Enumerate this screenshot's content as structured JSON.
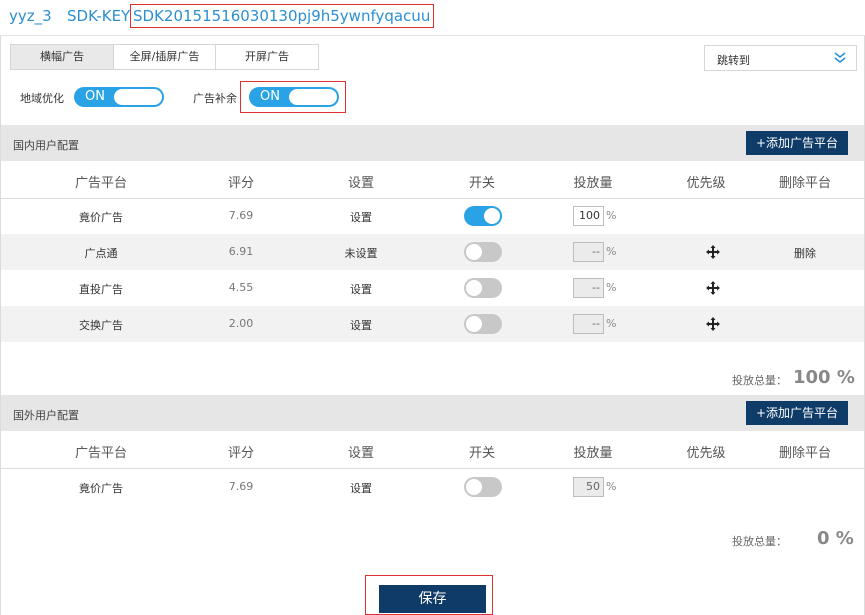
{
  "header": {
    "app_name": "yyz_3",
    "sdk_label": "SDK-KEY",
    "sdk_key": "SDK20151516030130pj9h5ywnfyqacuu"
  },
  "tabs": [
    {
      "label": "横幅广告",
      "active": true
    },
    {
      "label": "全屏/插屏广告",
      "active": false
    },
    {
      "label": "开屏广告",
      "active": false
    }
  ],
  "jump_select": {
    "label": "跳转到",
    "icon": "double-chevron-down-icon"
  },
  "options": {
    "geo_optimize": {
      "label": "地域优化",
      "state": "ON"
    },
    "ad_fill": {
      "label": "广告补余",
      "state": "ON"
    }
  },
  "domestic": {
    "title": "国内用户配置",
    "add_button": "+添加广告平台",
    "columns": [
      "广告平台",
      "评分",
      "设置",
      "开关",
      "投放量",
      "优先级",
      "删除平台"
    ],
    "rows": [
      {
        "platform": "竟价广告",
        "score": "7.69",
        "setting": "设置",
        "enabled": true,
        "quantity": "100",
        "unit": "%",
        "priority_icon": "",
        "delete": ""
      },
      {
        "platform": "广点通",
        "score": "6.91",
        "setting": "未设置",
        "enabled": false,
        "quantity": "--",
        "unit": "%",
        "priority_icon": "move-icon",
        "delete": "删除"
      },
      {
        "platform": "直投广告",
        "score": "4.55",
        "setting": "设置",
        "enabled": false,
        "quantity": "--",
        "unit": "%",
        "priority_icon": "move-icon",
        "delete": ""
      },
      {
        "platform": "交换广告",
        "score": "2.00",
        "setting": "设置",
        "enabled": false,
        "quantity": "--",
        "unit": "%",
        "priority_icon": "move-icon",
        "delete": ""
      }
    ],
    "total_label": "投放总量：",
    "total_value": "100 %"
  },
  "foreign": {
    "title": "国外用户配置",
    "add_button": "+添加广告平台",
    "columns": [
      "广告平台",
      "评分",
      "设置",
      "开关",
      "投放量",
      "优先级",
      "删除平台"
    ],
    "rows": [
      {
        "platform": "竟价广告",
        "score": "7.69",
        "setting": "设置",
        "enabled": false,
        "quantity": "50",
        "unit": "%",
        "priority_icon": "",
        "delete": ""
      }
    ],
    "total_label": "投放总量：",
    "total_value": "0 %"
  },
  "save_button": "保存",
  "colors": {
    "accent": "#2aa3e6",
    "dark_button": "#0f3b68",
    "highlight": "#e03030",
    "link_blue": "#2d8fd0"
  }
}
